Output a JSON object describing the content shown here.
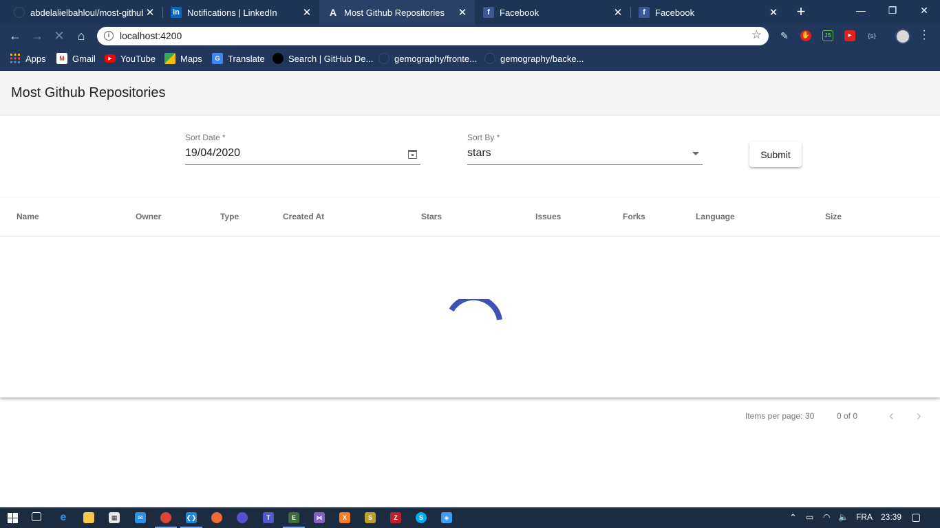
{
  "browser": {
    "tabs": [
      {
        "title": "abdelalielbahloul/most-github",
        "favicon": "github-icon",
        "active": false
      },
      {
        "title": "Notifications | LinkedIn",
        "favicon": "linkedin-icon",
        "active": false
      },
      {
        "title": "Most Github Repositories",
        "favicon": "angular-icon",
        "active": true
      },
      {
        "title": "Facebook",
        "favicon": "facebook-icon",
        "active": false
      },
      {
        "title": "Facebook",
        "favicon": "facebook-icon",
        "active": false
      }
    ],
    "url": "localhost:4200",
    "bookmarks": [
      {
        "label": "Apps",
        "icon": "apps-grid-icon"
      },
      {
        "label": "Gmail",
        "icon": "gmail-icon"
      },
      {
        "label": "YouTube",
        "icon": "youtube-icon"
      },
      {
        "label": "Maps",
        "icon": "maps-icon"
      },
      {
        "label": "Translate",
        "icon": "translate-icon"
      },
      {
        "label": "Search | GitHub De...",
        "icon": "github-icon"
      },
      {
        "label": "gemography/fronte...",
        "icon": "github-icon"
      },
      {
        "label": "gemography/backe...",
        "icon": "github-icon"
      }
    ]
  },
  "page": {
    "title": "Most Github Repositories",
    "form": {
      "sort_date_label": "Sort Date *",
      "sort_date_value": "19/04/2020",
      "sort_by_label": "Sort By *",
      "sort_by_value": "stars",
      "submit_label": "Submit"
    },
    "table": {
      "columns": [
        "Name",
        "Owner",
        "Type",
        "Created At",
        "Stars",
        "Issues",
        "Forks",
        "Language",
        "Size"
      ],
      "loading": true
    },
    "paginator": {
      "items_per_page_label": "Items per page:",
      "items_per_page_value": "30",
      "range": "0 of 0"
    }
  },
  "taskbar": {
    "language": "FRA",
    "time": "23:39"
  },
  "colors": {
    "chrome_frame": "#1f3558",
    "spinner": "#3f51b5",
    "page_header": "#f5f5f5"
  }
}
